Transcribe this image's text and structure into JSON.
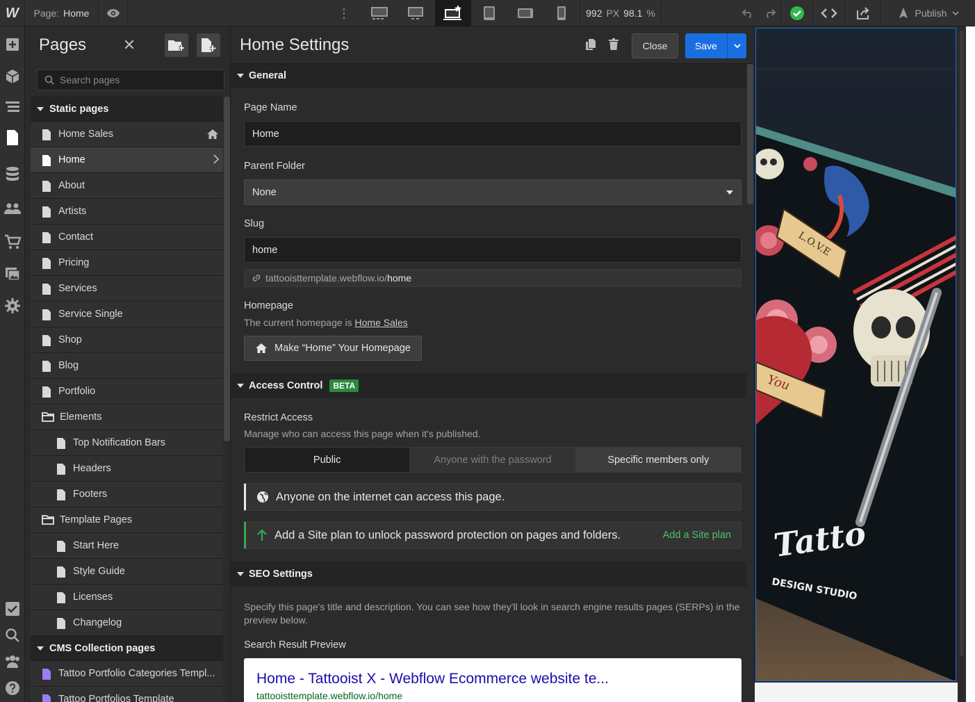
{
  "topbar": {
    "logo": "W",
    "page_prefix": "Page:",
    "page_name": "Home",
    "more": "⋮",
    "width_value": "992",
    "width_unit": "PX",
    "zoom_value": "98.1",
    "zoom_unit": "%",
    "publish_label": "Publish"
  },
  "pages_panel": {
    "title": "Pages",
    "close": "✕",
    "search_placeholder": "Search pages",
    "static_section": "Static pages",
    "static_pages": [
      {
        "label": "Home Sales",
        "badge": "home-icon"
      },
      {
        "label": "Home",
        "current": true
      },
      {
        "label": "About"
      },
      {
        "label": "Artists"
      },
      {
        "label": "Contact"
      },
      {
        "label": "Pricing"
      },
      {
        "label": "Services"
      },
      {
        "label": "Service Single"
      },
      {
        "label": "Shop"
      },
      {
        "label": "Blog"
      },
      {
        "label": "Portfolio"
      }
    ],
    "folders": [
      {
        "label": "Elements",
        "children": [
          "Top Notification Bars",
          "Headers",
          "Footers"
        ]
      },
      {
        "label": "Template Pages",
        "children": [
          "Start Here",
          "Style Guide",
          "Licenses",
          "Changelog"
        ]
      }
    ],
    "cms_section": "CMS Collection pages",
    "cms_pages": [
      "Tattoo Portfolio Categories Templ...",
      "Tattoo Portfolios Template"
    ]
  },
  "settings": {
    "title": "Home Settings",
    "close_label": "Close",
    "save_label": "Save",
    "general": {
      "heading": "General",
      "page_name_label": "Page Name",
      "page_name_value": "Home",
      "parent_folder_label": "Parent Folder",
      "parent_folder_value": "None",
      "slug_label": "Slug",
      "slug_value": "home",
      "url_base": "tattooisttemplate.webflow.io/",
      "url_slug": "home",
      "homepage_label": "Homepage",
      "homepage_help": "The current homepage is",
      "homepage_link": "Home Sales",
      "make_home_label": "Make “Home” Your Homepage"
    },
    "access": {
      "heading": "Access Control",
      "badge": "BETA",
      "restrict_label": "Restrict Access",
      "restrict_help": "Manage who can access this page when it's published.",
      "options": [
        "Public",
        "Anyone with the password",
        "Specific members only"
      ],
      "selected": "Public",
      "notice_public": "Anyone on the internet can access this page.",
      "notice_plan": "Add a Site plan to unlock password protection on pages and folders.",
      "plan_link": "Add a Site plan"
    },
    "seo": {
      "heading": "SEO Settings",
      "help": "Specify this page's title and description. You can see how they'll look in search engine results pages (SERPs) in the preview below.",
      "preview_label": "Search Result Preview",
      "preview_title": "Home - Tattooist X - Webflow Ecommerce website te...",
      "preview_url": "tattooisttemplate.webflow.io/home"
    }
  },
  "canvas": {
    "logo_script": "Tatto",
    "logo_sub": "DESIGN STUDIO",
    "banner_love": "L.O.V.E",
    "banner_you": "You"
  },
  "colors": {
    "accent": "#1a6fe0",
    "success": "#34a853",
    "beta": "#2a8a3d",
    "serp_title": "#1a0dab",
    "serp_url": "#006621"
  }
}
